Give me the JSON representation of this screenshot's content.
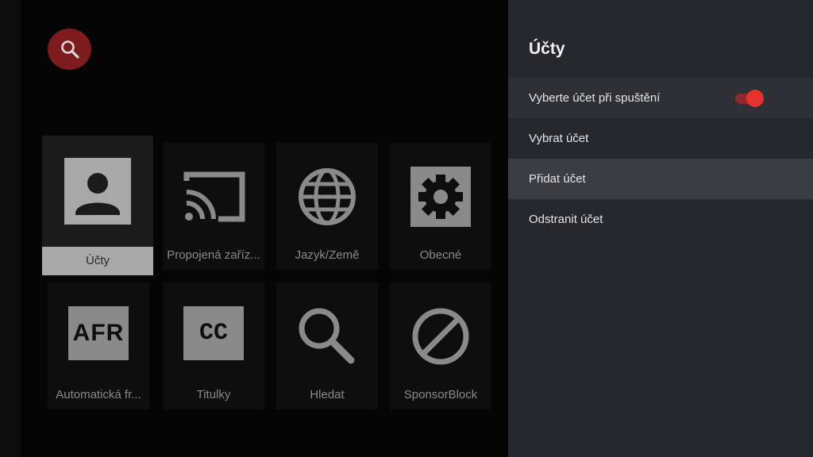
{
  "search": {
    "icon": "search-icon",
    "color": "#7d1b1e"
  },
  "tiles": [
    {
      "label": "Účty",
      "icon": "account-icon",
      "selected": true
    },
    {
      "label": "Propojená zaříz...",
      "icon": "cast-icon"
    },
    {
      "label": "Jazyk/Země",
      "icon": "globe-icon"
    },
    {
      "label": "Obecné",
      "icon": "gear-icon"
    },
    {
      "label": "Automatická fr...",
      "icon": "afr-icon",
      "icon_text": "AFR"
    },
    {
      "label": "Titulky",
      "icon": "captions-icon",
      "icon_text": "CC"
    },
    {
      "label": "Hledat",
      "icon": "search-icon"
    },
    {
      "label": "SponsorBlock",
      "icon": "block-icon"
    }
  ],
  "panel": {
    "title": "Účty",
    "items": [
      {
        "label": "Vyberte účet při spuštění",
        "toggle": true
      },
      {
        "label": "Vybrat účet"
      },
      {
        "label": "Přidat účet",
        "focused": true
      },
      {
        "label": "Odstranit účet"
      }
    ]
  },
  "colors": {
    "accent": "#e5322f",
    "panel_bg": "#27282d"
  }
}
